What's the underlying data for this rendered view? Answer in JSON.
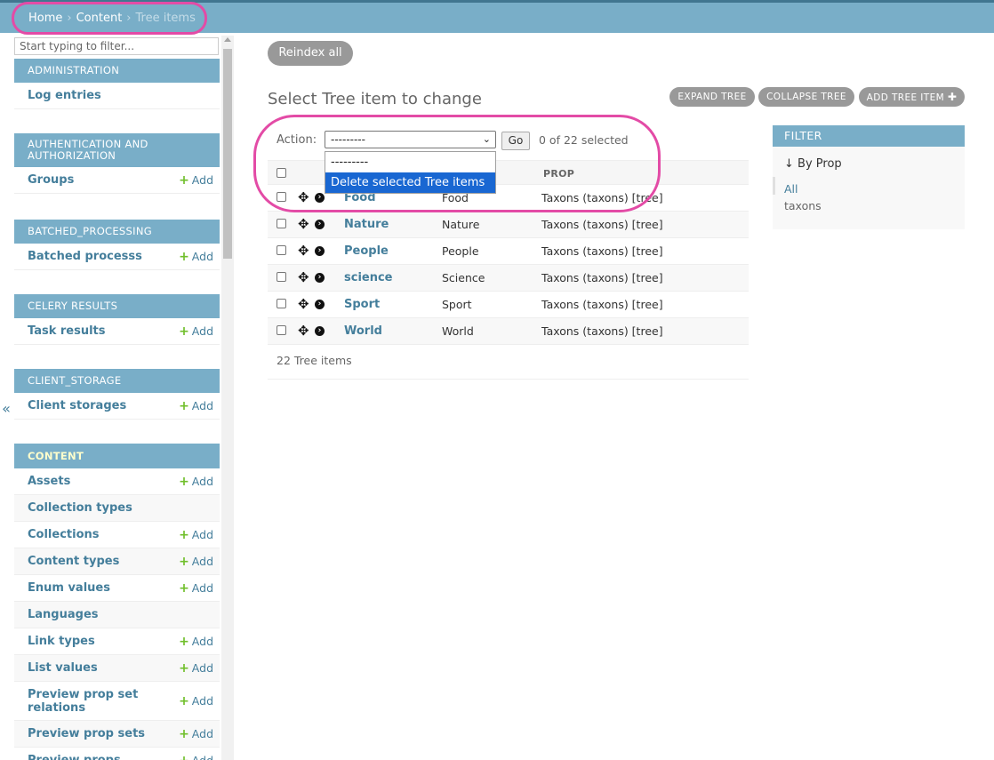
{
  "breadcrumb": {
    "home": "Home",
    "sep": "›",
    "section": "Content",
    "current": "Tree items"
  },
  "sidebar": {
    "filter_placeholder": "Start typing to filter...",
    "collapse_glyph": "«",
    "add_label": "Add",
    "modules": [
      {
        "caption": "Administration",
        "models": [
          {
            "name": "Log entries",
            "add": false
          }
        ]
      },
      {
        "caption": "Authentication and Authorization",
        "models": [
          {
            "name": "Groups",
            "add": true
          }
        ]
      },
      {
        "caption": "Batched_processing",
        "models": [
          {
            "name": "Batched processs",
            "add": true
          }
        ]
      },
      {
        "caption": "Celery Results",
        "models": [
          {
            "name": "Task results",
            "add": true
          }
        ]
      },
      {
        "caption": "Client_storage",
        "models": [
          {
            "name": "Client storages",
            "add": true
          }
        ]
      },
      {
        "caption": "Content",
        "active": true,
        "models": [
          {
            "name": "Assets",
            "add": true
          },
          {
            "name": "Collection types",
            "add": false
          },
          {
            "name": "Collections",
            "add": true
          },
          {
            "name": "Content types",
            "add": true
          },
          {
            "name": "Enum values",
            "add": true
          },
          {
            "name": "Languages",
            "add": false
          },
          {
            "name": "Link types",
            "add": true
          },
          {
            "name": "List values",
            "add": true
          },
          {
            "name": "Preview prop set relations",
            "add": true
          },
          {
            "name": "Preview prop sets",
            "add": true
          },
          {
            "name": "Preview props",
            "add": true
          }
        ]
      }
    ]
  },
  "toolbar": {
    "reindex_label": "Reindex all",
    "expand_label": "EXPAND TREE",
    "collapse_label": "COLLAPSE TREE",
    "add_label": "ADD TREE ITEM",
    "add_icon": "✚"
  },
  "page_title": "Select Tree item to change",
  "actions": {
    "label": "Action:",
    "selected_value": "---------",
    "go_label": "Go",
    "counter": "0 of 22 selected",
    "options": [
      {
        "label": "---------",
        "highlighted": false
      },
      {
        "label": "Delete selected Tree items",
        "highlighted": true
      }
    ]
  },
  "table": {
    "columns": [
      "",
      "",
      "",
      "PROP"
    ],
    "rows": [
      {
        "name": "Food",
        "title": "Food",
        "prop": "Taxons (taxons) [tree]"
      },
      {
        "name": "Nature",
        "title": "Nature",
        "prop": "Taxons (taxons) [tree]"
      },
      {
        "name": "People",
        "title": "People",
        "prop": "Taxons (taxons) [tree]"
      },
      {
        "name": "science",
        "title": "Science",
        "prop": "Taxons (taxons) [tree]"
      },
      {
        "name": "Sport",
        "title": "Sport",
        "prop": "Taxons (taxons) [tree]"
      },
      {
        "name": "World",
        "title": "World",
        "prop": "Taxons (taxons) [tree]"
      }
    ],
    "move_icon": "✥",
    "arrow_icon": "›"
  },
  "paginator": "22 Tree items",
  "filter": {
    "header": "FILTER",
    "by_label": "↓ By Prop",
    "options": [
      "All",
      "taxons"
    ]
  }
}
